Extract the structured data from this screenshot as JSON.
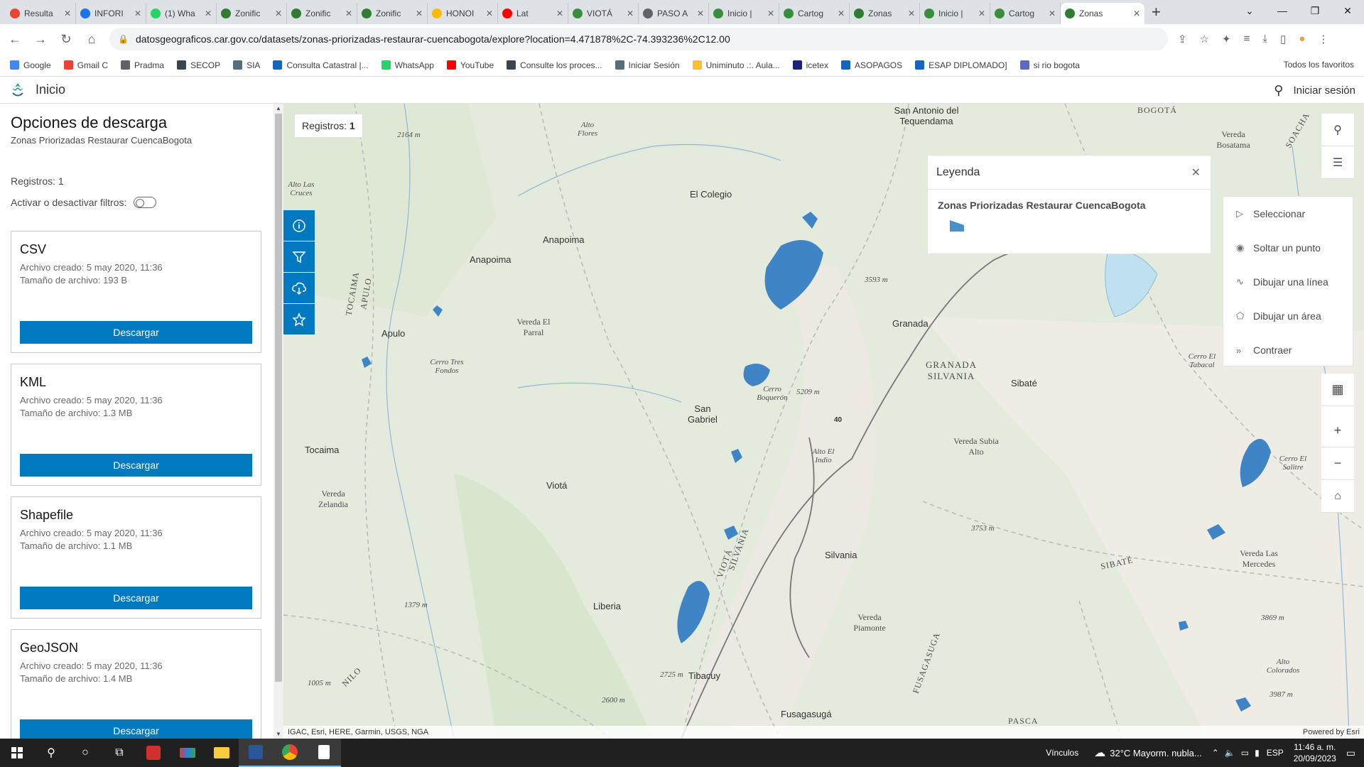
{
  "browser": {
    "tabs": [
      {
        "title": "Resulta",
        "color": "#ea4335"
      },
      {
        "title": "INFORI",
        "color": "#1a73e8"
      },
      {
        "title": "(1) Wha",
        "color": "#25d366"
      },
      {
        "title": "Zonific",
        "color": "#2e7d32"
      },
      {
        "title": "Zonific",
        "color": "#2e7d32"
      },
      {
        "title": "Zonific",
        "color": "#2e7d32"
      },
      {
        "title": "HONOI",
        "color": "#fbbc04"
      },
      {
        "title": "Lat",
        "color": "#ff0000"
      },
      {
        "title": "VIOTÁ",
        "color": "#388e3c"
      },
      {
        "title": "PASO A",
        "color": "#5f6368"
      },
      {
        "title": "Inicio |",
        "color": "#388e3c"
      },
      {
        "title": "Cartog",
        "color": "#388e3c"
      },
      {
        "title": "Zonas",
        "color": "#2e7d32"
      },
      {
        "title": "Inicio |",
        "color": "#388e3c"
      },
      {
        "title": "Cartog",
        "color": "#388e3c"
      }
    ],
    "active_tab": {
      "title": "Zonas",
      "color": "#2e7d32"
    },
    "url": "datosgeograficos.car.gov.co/datasets/zonas-priorizadas-restaurar-cuencabogota/explore?location=4.471878%2C-74.393236%2C12.00",
    "bookmarks": [
      {
        "label": "Google",
        "color": "#4285f4"
      },
      {
        "label": "Gmail C",
        "color": "#ea4335"
      },
      {
        "label": "Pradma",
        "color": "#5f6368"
      },
      {
        "label": "SECOP",
        "color": "#37474f"
      },
      {
        "label": "SIA",
        "color": "#546e7a"
      },
      {
        "label": "Consulta Catastral |...",
        "color": "#1565c0"
      },
      {
        "label": "WhatsApp",
        "color": "#25d366"
      },
      {
        "label": "YouTube",
        "color": "#ff0000"
      },
      {
        "label": "Consulte los proces...",
        "color": "#37474f"
      },
      {
        "label": "Iniciar Sesión",
        "color": "#546e7a"
      },
      {
        "label": "Uniminuto .:. Aula...",
        "color": "#fbc02d"
      },
      {
        "label": "icetex",
        "color": "#1a237e"
      },
      {
        "label": "ASOPAGOS",
        "color": "#1565c0"
      },
      {
        "label": "ESAP DIPLOMADO]",
        "color": "#1565c0"
      },
      {
        "label": "si rio bogota",
        "color": "#5c6bc0"
      }
    ],
    "all_bookmarks": "Todos los favoritos"
  },
  "header": {
    "home": "Inicio",
    "signin": "Iniciar sesión"
  },
  "panel": {
    "title": "Opciones de descarga",
    "subtitle": "Zonas Priorizadas Restaurar CuencaBogota",
    "records": "Registros: 1",
    "filters": "Activar o desactivar filtros:",
    "cards": [
      {
        "format": "CSV",
        "created": "Archivo creado: 5 may 2020, 11:36",
        "size": "Tamaño de archivo: 193 B",
        "button": "Descargar"
      },
      {
        "format": "KML",
        "created": "Archivo creado: 5 may 2020, 11:36",
        "size": "Tamaño de archivo: 1.3 MB",
        "button": "Descargar"
      },
      {
        "format": "Shapefile",
        "created": "Archivo creado: 5 may 2020, 11:36",
        "size": "Tamaño de archivo: 1.1 MB",
        "button": "Descargar"
      },
      {
        "format": "GeoJSON",
        "created": "Archivo creado: 5 may 2020, 11:36",
        "size": "Tamaño de archivo: 1.4 MB",
        "button": "Descargar"
      }
    ]
  },
  "map": {
    "records_label": "Registros:",
    "records_value": "1",
    "legend": {
      "title": "Leyenda",
      "layer": "Zonas Priorizadas Restaurar CuencaBogota",
      "swatch_color": "#4a90c8"
    },
    "sketch_tools": [
      {
        "label": "Seleccionar",
        "icon": "▷"
      },
      {
        "label": "Soltar un punto",
        "icon": "◉"
      },
      {
        "label": "Dibujar una línea",
        "icon": "∿"
      },
      {
        "label": "Dibujar un área",
        "icon": "⬠"
      },
      {
        "label": "Contraer",
        "icon": "»"
      }
    ],
    "attribution": "IGAC, Esri, HERE, Garmin, USGS, NGA",
    "powered": "Powered by Esri",
    "labels": {
      "antonio": "San Antonio del Tequendama",
      "el_colegio": "El Colegio",
      "anapoima1": "Anapoima",
      "anapoima2": "Anapoima",
      "apulo": "Apulo",
      "granada": "Granada",
      "granada_silvania": "GRANADA SILVANIA",
      "sibate": "Sibaté",
      "san_gabriel": "San Gabriel",
      "cerro_boqueron": "Cerro Boquerón",
      "tocaima": "Tocaima",
      "viota": "Viotá",
      "silvania": "Silvania",
      "liberia": "Liberia",
      "tibacuy": "Tibacuy",
      "fusagasuga": "Fusagasugá",
      "vereda_parral": "Vereda El Parral",
      "vereda_zelandia": "Vereda Zelandia",
      "vereda_piamonte": "Vereda Piamonte",
      "vereda_subia": "Vereda Subia Alto",
      "vereda_mercedes": "Vereda Las Mercedes",
      "vereda_bosatama": "Vereda Bosatama",
      "cerro_tres": "Cerro Tres Fondos",
      "alto_flores": "Alto Flores",
      "alto_cruces": "Alto Las Cruces",
      "alto_indio": "Alto El Indio",
      "cerro_salitre": "Cerro El Salitre",
      "cerro_tabacal": "Cerro El Tabacal",
      "alto_colorados": "Alto Colorados",
      "tocaima_r": "TOCAIMA",
      "apulo_r": "APULO",
      "viota_r": "VIOTÁ",
      "silvania_r": "SILVANIA",
      "sibate_r": "SIBATÉ",
      "soacha_r": "SOACHA",
      "nilo_r": "NILO",
      "fusagasuga_r": "FUSAGASUGA",
      "pasca_r": "PASCA",
      "bogota_r": "BOGOTÁ",
      "e2164": "2164 m",
      "e3593": "3593 m",
      "e5209": "5209 m",
      "e3753": "3753 m",
      "e1379": "1379 m",
      "e2725": "2725 m",
      "e2600": "2600 m",
      "e1005": "1005 m",
      "e3869": "3869 m",
      "e3987": "3987 m",
      "r40": "40"
    }
  },
  "taskbar": {
    "links": "Vínculos",
    "weather": "32°C  Mayorm. nubla...",
    "lang": "ESP",
    "time": "11:46 a. m.",
    "date": "20/09/2023"
  }
}
